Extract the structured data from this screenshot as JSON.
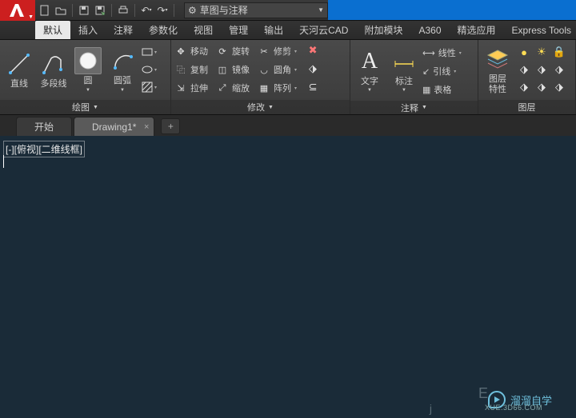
{
  "app": {
    "name": "AutoCAD"
  },
  "workspace": {
    "label": "草图与注释"
  },
  "tabs": {
    "items": [
      {
        "label": "默认",
        "active": true
      },
      {
        "label": "插入"
      },
      {
        "label": "注释"
      },
      {
        "label": "参数化"
      },
      {
        "label": "视图"
      },
      {
        "label": "管理"
      },
      {
        "label": "输出"
      },
      {
        "label": "天河云CAD"
      },
      {
        "label": "附加模块"
      },
      {
        "label": "A360"
      },
      {
        "label": "精选应用"
      },
      {
        "label": "Express Tools"
      }
    ]
  },
  "panels": {
    "draw": {
      "title": "绘图",
      "buttons": {
        "line": "直线",
        "polyline": "多段线",
        "circle": "圆",
        "arc": "圆弧"
      }
    },
    "modify": {
      "title": "修改",
      "rows": [
        {
          "icon": "move",
          "label": "移动"
        },
        {
          "icon": "copy",
          "label": "复制"
        },
        {
          "icon": "stretch",
          "label": "拉伸"
        }
      ],
      "rows2": [
        {
          "icon": "rotate",
          "label": "旋转"
        },
        {
          "icon": "mirror",
          "label": "镜像"
        },
        {
          "icon": "scale",
          "label": "缩放"
        }
      ],
      "rows3": [
        {
          "icon": "trim",
          "label": "修剪"
        },
        {
          "icon": "fillet",
          "label": "圆角"
        },
        {
          "icon": "array",
          "label": "阵列"
        }
      ]
    },
    "annot": {
      "title": "注释",
      "text_label": "文字",
      "dim_label": "标注",
      "linetype": "线性",
      "leader": "引线",
      "table": "表格"
    },
    "layers": {
      "title": "图层",
      "props": "图层\n特性"
    }
  },
  "doc_tabs": {
    "start": "开始",
    "drawing": "Drawing1*"
  },
  "viewport": {
    "label": "[-][俯视][二维线框]"
  },
  "watermark": {
    "brand": "溜溜自学",
    "url": "XUE.3D66.COM"
  },
  "ghost": {
    "e": "E",
    "j": "j"
  }
}
